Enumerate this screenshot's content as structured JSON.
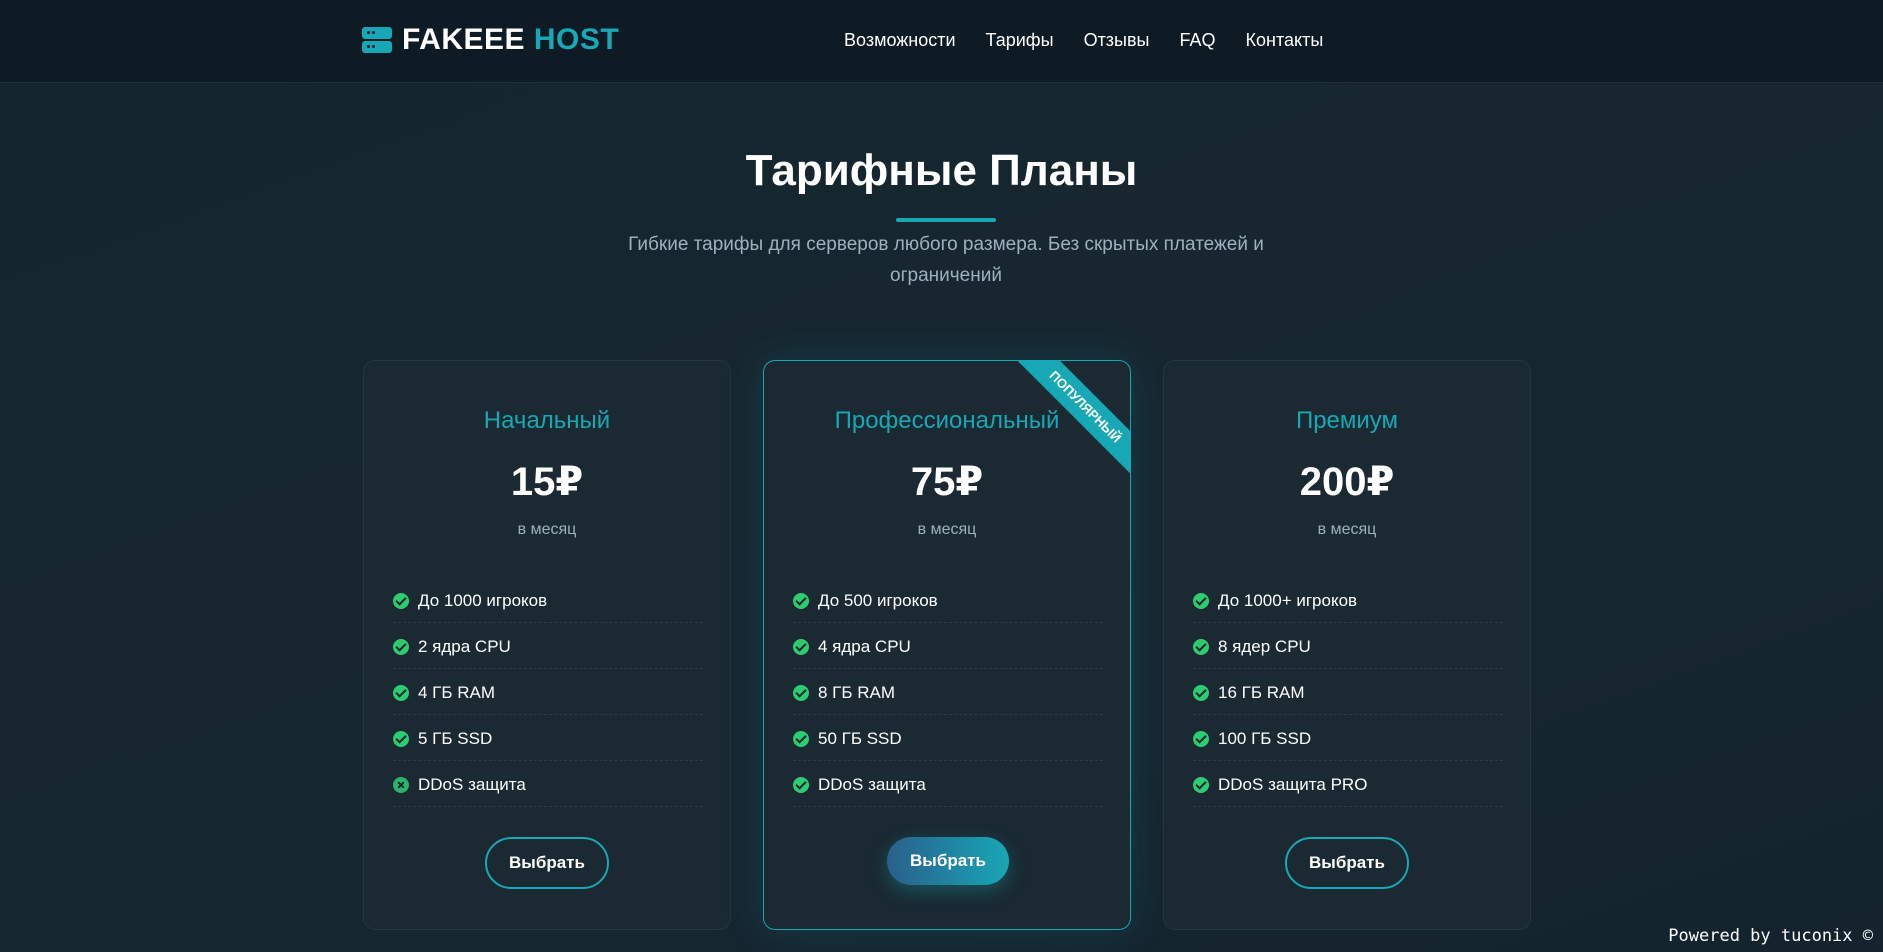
{
  "brand": {
    "name_primary": "FAKEEE",
    "name_accent": "HOST",
    "accent_color": "#18a7b5",
    "icon": "server-icon"
  },
  "nav": {
    "items": [
      "Возможности",
      "Тарифы",
      "Отзывы",
      "FAQ",
      "Контакты"
    ]
  },
  "section": {
    "title": "Тарифные Планы",
    "subtitle": "Гибкие тарифы для серверов любого размера. Без скрытых платежей и ограничений"
  },
  "plans": [
    {
      "name": "Начальный",
      "price": "15₽",
      "period": "в месяц",
      "features": [
        {
          "text": "До 1000 игроков",
          "included": true
        },
        {
          "text": "2 ядра CPU",
          "included": true
        },
        {
          "text": "4 ГБ RAM",
          "included": true
        },
        {
          "text": "5 ГБ SSD",
          "included": true
        },
        {
          "text": "DDoS защита",
          "included": false
        }
      ],
      "button": "Выбрать"
    },
    {
      "name": "Профессиональный",
      "price": "75₽",
      "period": "в месяц",
      "badge": "Популярный",
      "features": [
        {
          "text": "До 500 игроков",
          "included": true
        },
        {
          "text": "4 ядра CPU",
          "included": true
        },
        {
          "text": "8 ГБ RAM",
          "included": true
        },
        {
          "text": "50 ГБ SSD",
          "included": true
        },
        {
          "text": "DDoS защита",
          "included": true
        }
      ],
      "button": "Выбрать"
    },
    {
      "name": "Премиум",
      "price": "200₽",
      "period": "в месяц",
      "features": [
        {
          "text": "До 1000+ игроков",
          "included": true
        },
        {
          "text": "8 ядер CPU",
          "included": true
        },
        {
          "text": "16 ГБ RAM",
          "included": true
        },
        {
          "text": "100 ГБ SSD",
          "included": true
        },
        {
          "text": "DDoS защита PRO",
          "included": true
        }
      ],
      "button": "Выбрать"
    }
  ],
  "footer": {
    "powered": "Powered by tuconix ©"
  },
  "colors": {
    "background": "#162631",
    "header": "#0e1a24",
    "card": "#1a2932",
    "accent": "#18a7b5",
    "check": "#2ecc71",
    "muted_text": "#9fb1bf"
  }
}
